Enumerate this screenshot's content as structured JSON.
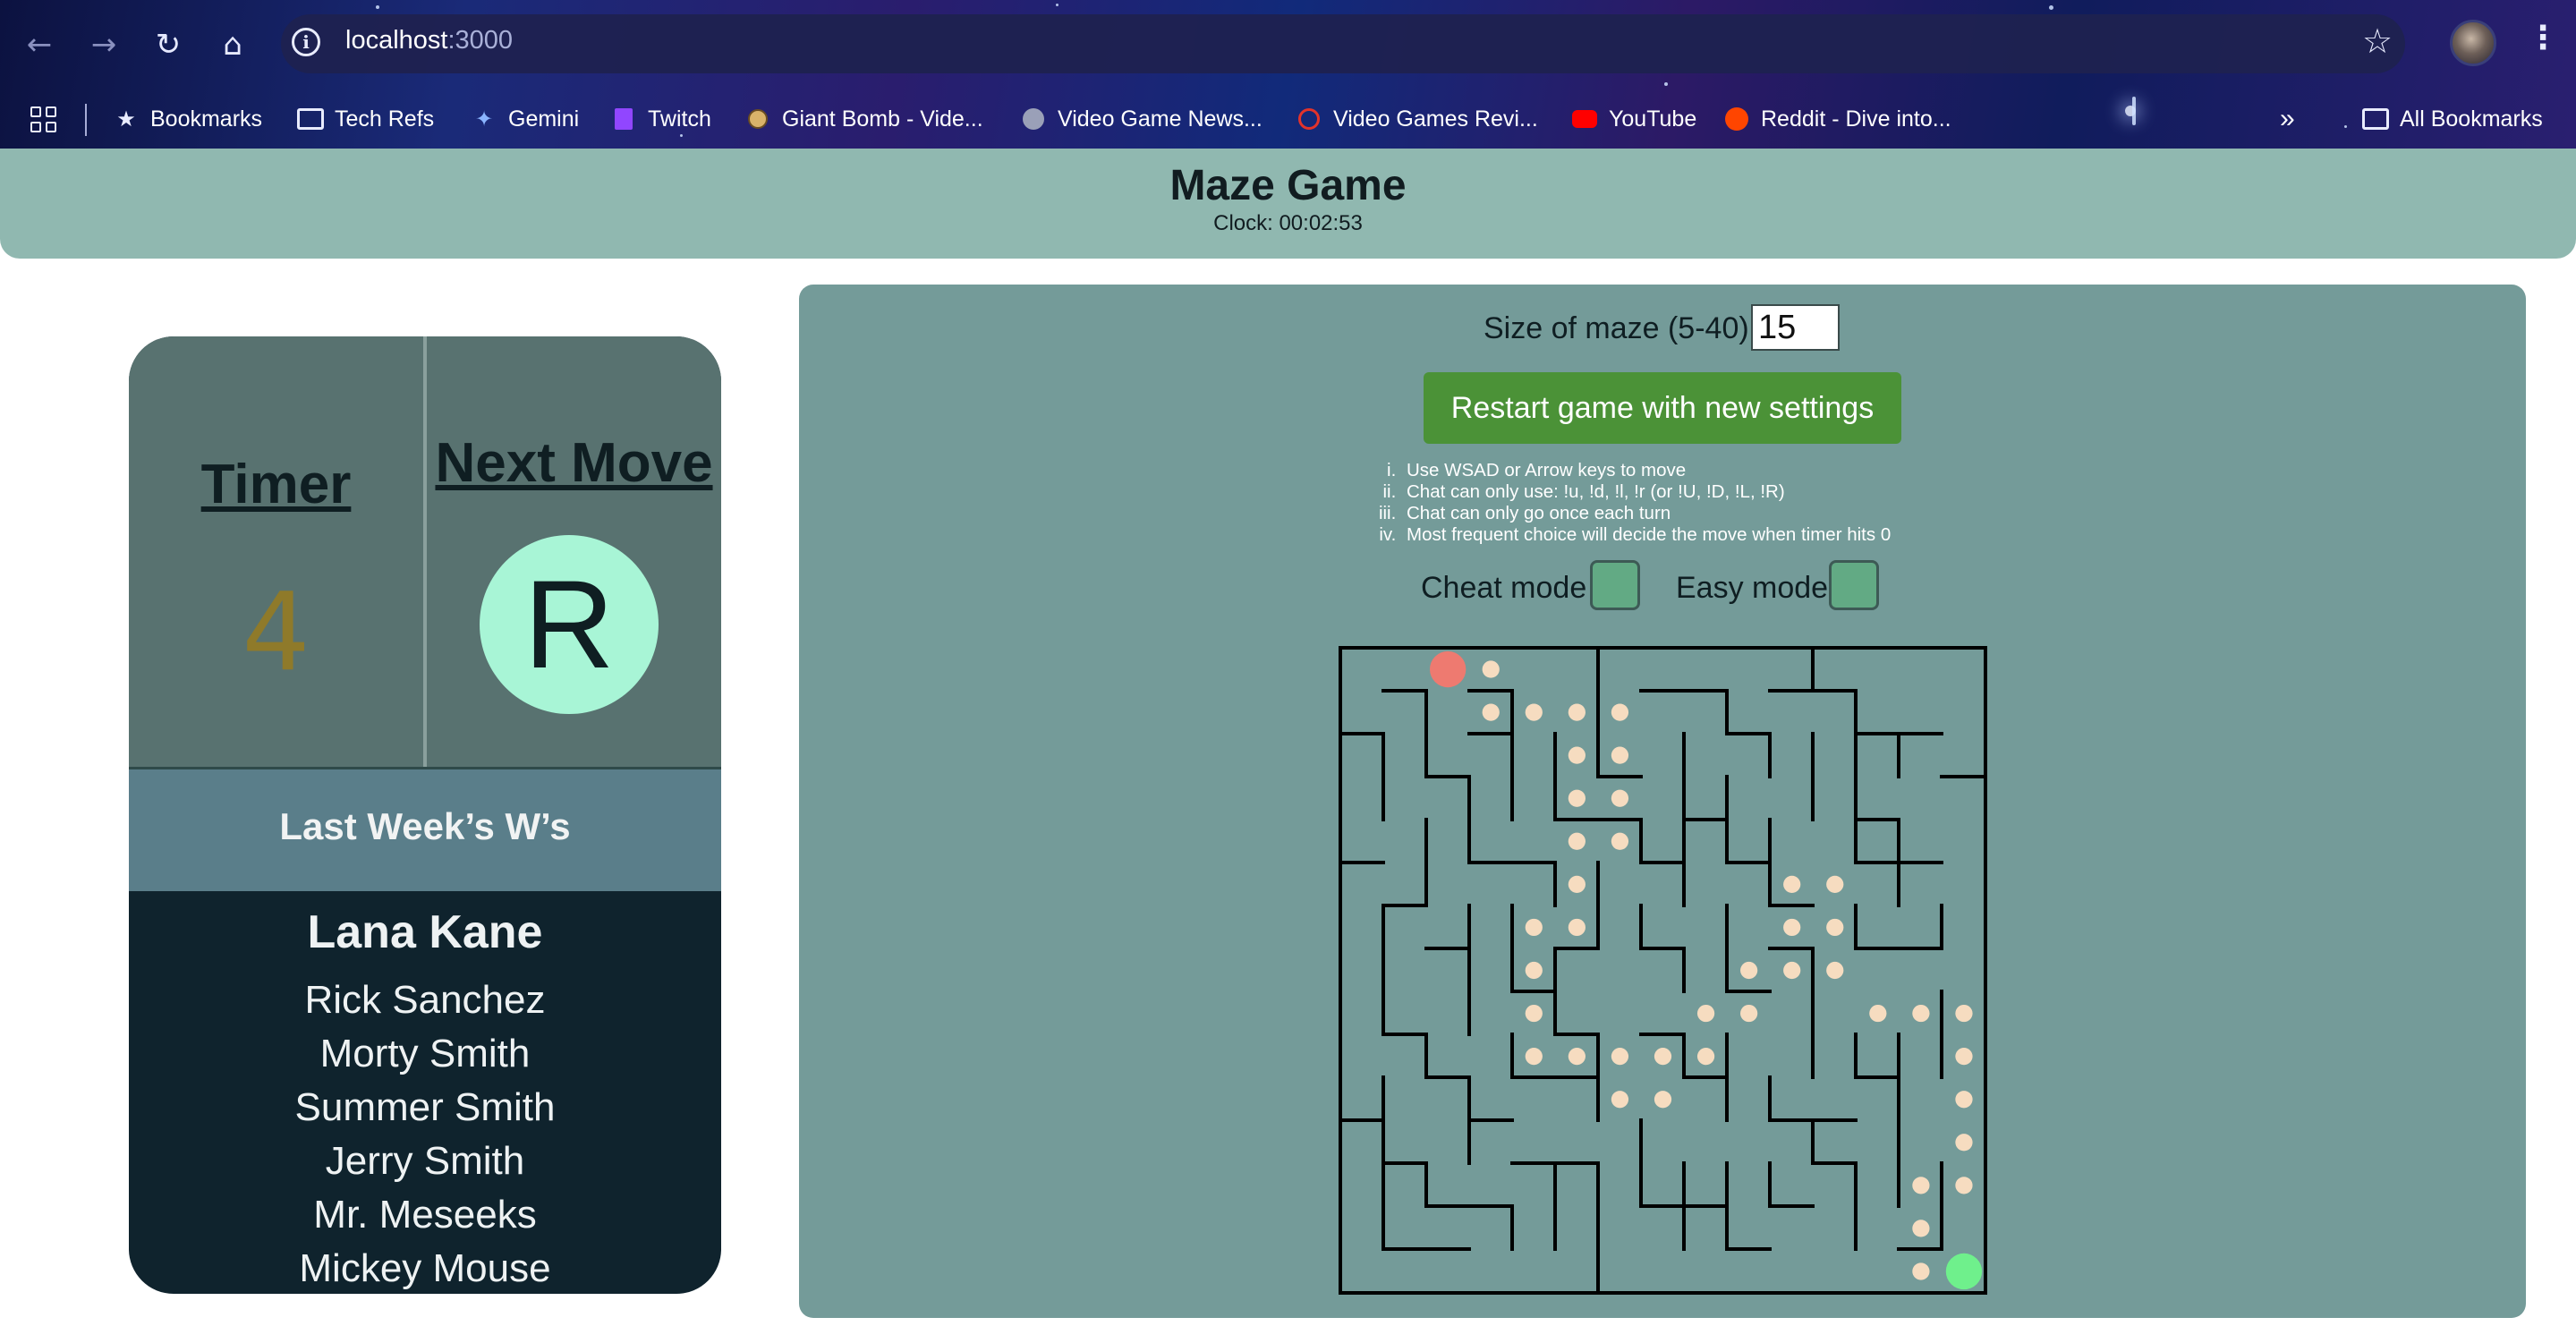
{
  "browser": {
    "url_host": "localhost",
    "url_port": ":3000",
    "bookmarks": [
      {
        "label": "Bookmarks",
        "icon": "star-icon"
      },
      {
        "label": "Tech Refs",
        "icon": "folder-icon"
      },
      {
        "label": "Gemini",
        "icon": "gemini-icon"
      },
      {
        "label": "Twitch",
        "icon": "twitch-icon"
      },
      {
        "label": "Giant Bomb - Vide...",
        "icon": "giant-bomb-icon"
      },
      {
        "label": "Video Game News...",
        "icon": "globe-icon"
      },
      {
        "label": "Video Games Revi...",
        "icon": "gamespot-icon"
      },
      {
        "label": "YouTube",
        "icon": "youtube-icon"
      },
      {
        "label": "Reddit - Dive into...",
        "icon": "reddit-icon"
      }
    ],
    "overflow_label": "»",
    "all_bookmarks_label": "All Bookmarks"
  },
  "header": {
    "title": "Maze Game",
    "clock": "Clock: 00:02:53"
  },
  "card": {
    "timer_label": "Timer",
    "timer_value": "4",
    "next_move_label": "Next Move",
    "next_move_value": "R",
    "wins_title": "Last Week’s W’s",
    "winners": [
      "Lana Kane",
      "Rick Sanchez",
      "Morty Smith",
      "Summer Smith",
      "Jerry Smith",
      "Mr. Meseeks",
      "Mickey Mouse"
    ]
  },
  "settings": {
    "size_label": "Size of maze (5-40):",
    "size_value": "15",
    "restart_label": "Restart game with new settings",
    "rules": [
      "Use WSAD or Arrow keys to move",
      "Chat can only use: !u, !d, !l, !r (or !U, !D, !L, !R)",
      "Chat can only go once each turn",
      "Most frequent choice will decide the move when timer hits 0"
    ],
    "cheat_label": "Cheat mode",
    "easy_label": "Easy mode"
  },
  "colors": {
    "header_bg": "#90b8b0",
    "panel_bg": "#749b99",
    "restart_button": "#4b9237",
    "player": "#ee7a70",
    "goal": "#6ff08c",
    "path_dot": "#f6dcc0",
    "timer_value": "#8f7a2a",
    "next_move_circle": "#a8f5d6"
  },
  "maze": {
    "size": 15,
    "player_cell": [
      2,
      0
    ],
    "goal_cell": [
      14,
      14
    ],
    "path": [
      [
        3,
        0
      ],
      [
        3,
        1
      ],
      [
        4,
        1
      ],
      [
        5,
        1
      ],
      [
        6,
        1
      ],
      [
        5,
        2
      ],
      [
        6,
        2
      ],
      [
        5,
        3
      ],
      [
        6,
        3
      ],
      [
        5,
        4
      ],
      [
        6,
        4
      ],
      [
        5,
        5
      ],
      [
        4,
        6
      ],
      [
        5,
        6
      ],
      [
        4,
        7
      ],
      [
        4,
        8
      ],
      [
        4,
        9
      ],
      [
        5,
        9
      ],
      [
        6,
        9
      ],
      [
        7,
        9
      ],
      [
        8,
        9
      ],
      [
        6,
        10
      ],
      [
        7,
        10
      ],
      [
        8,
        8
      ],
      [
        9,
        8
      ],
      [
        9,
        7
      ],
      [
        10,
        7
      ],
      [
        11,
        7
      ],
      [
        10,
        6
      ],
      [
        11,
        6
      ],
      [
        10,
        5
      ],
      [
        11,
        5
      ],
      [
        12,
        8
      ],
      [
        13,
        8
      ],
      [
        14,
        8
      ],
      [
        14,
        9
      ],
      [
        14,
        10
      ],
      [
        14,
        11
      ],
      [
        13,
        12
      ],
      [
        14,
        12
      ],
      [
        13,
        13
      ],
      [
        13,
        14
      ]
    ]
  }
}
